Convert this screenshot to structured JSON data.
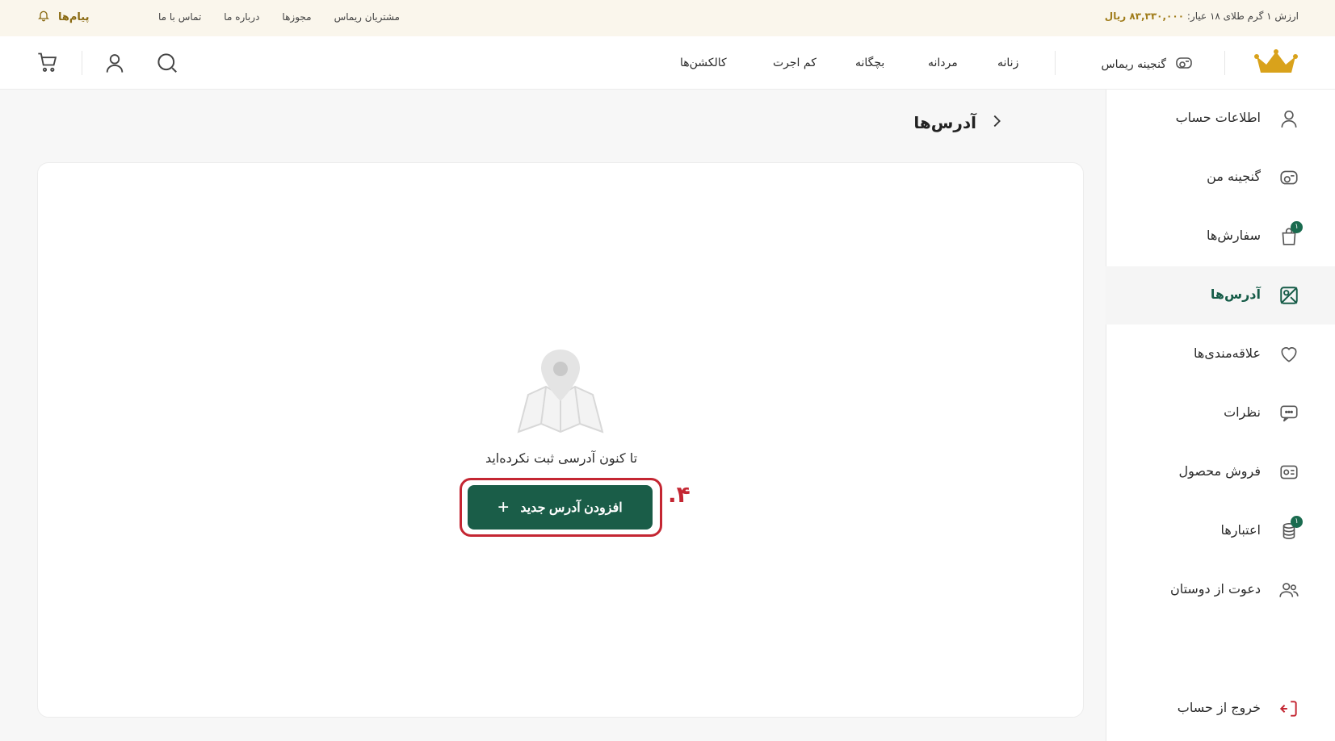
{
  "topbar": {
    "gold_price_label": "ارزش ۱ گرم طلای ۱۸ عیار:",
    "gold_price_value": "۸۳,۳۳۰,۰۰۰ ریال",
    "links": [
      "مشتریان ریماس",
      "مجوزها",
      "درباره ما",
      "تماس با ما"
    ],
    "messages_label": "پیام‌ها"
  },
  "header": {
    "brand_label": "گنجینه ریماس",
    "nav": [
      "زنانه",
      "مردانه",
      "بچگانه",
      "کم اجرت",
      "کالکشن‌ها"
    ]
  },
  "sidebar": {
    "items": [
      {
        "label": "اطلاعات حساب",
        "icon": "user-icon"
      },
      {
        "label": "گنجینه من",
        "icon": "treasury-icon"
      },
      {
        "label": "سفارش‌ها",
        "icon": "shopping-bag-icon",
        "badge": "۱"
      },
      {
        "label": "آدرس‌ها",
        "icon": "map-icon",
        "active": true
      },
      {
        "label": "علاقه‌مندی‌ها",
        "icon": "heart-icon"
      },
      {
        "label": "نظرات",
        "icon": "comment-icon"
      },
      {
        "label": "فروش محصول",
        "icon": "sell-icon"
      },
      {
        "label": "اعتبارها",
        "icon": "coins-icon",
        "badge": "۱"
      },
      {
        "label": "دعوت از دوستان",
        "icon": "users-icon"
      }
    ],
    "logout_label": "خروج از حساب"
  },
  "main": {
    "title": "آدرس‌ها",
    "empty_text": "تا کنون آدرسی ثبت نکرده‌اید",
    "add_button_label": "افزودن آدرس جدید",
    "step_annotation": ".۴"
  },
  "colors": {
    "accent_green": "#1a5d48",
    "gold": "#a07c1a",
    "highlight_red": "#c42632"
  }
}
